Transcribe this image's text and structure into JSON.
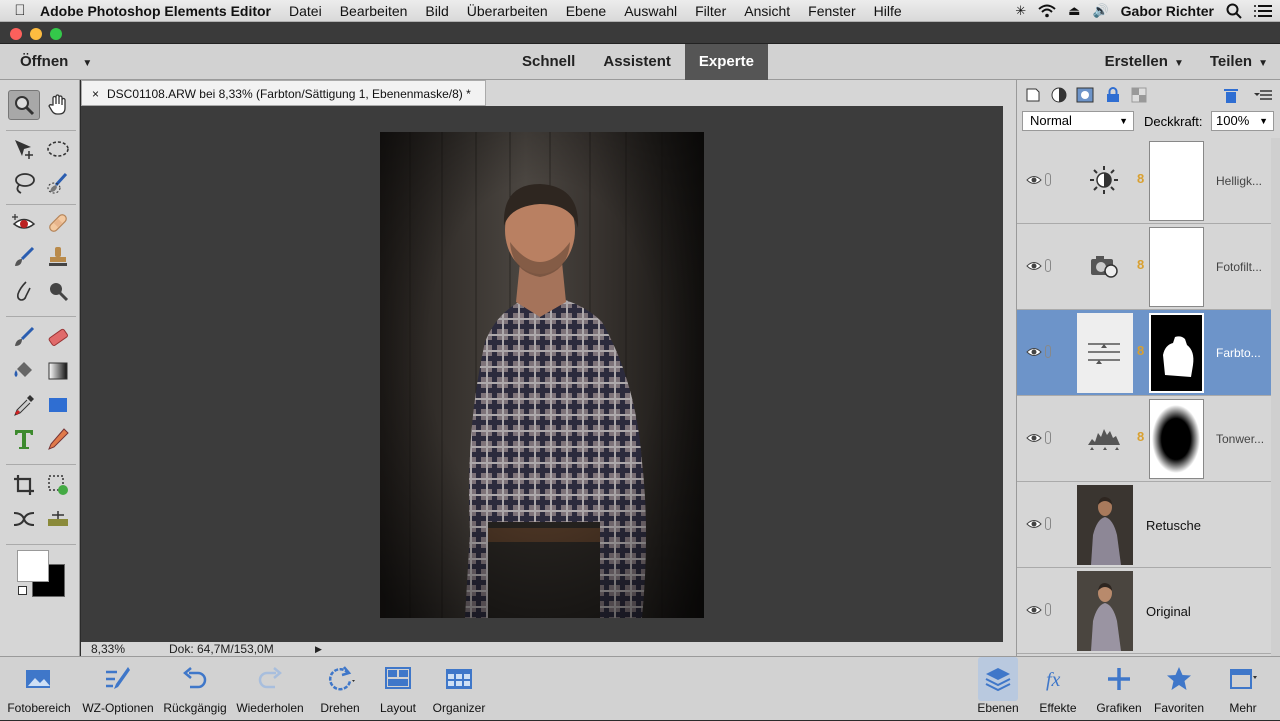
{
  "menubar": {
    "app_name": "Adobe Photoshop Elements Editor",
    "items": [
      "Datei",
      "Bearbeiten",
      "Bild",
      "Überarbeiten",
      "Ebene",
      "Auswahl",
      "Filter",
      "Ansicht",
      "Fenster",
      "Hilfe"
    ],
    "user": "Gabor Richter"
  },
  "topbar": {
    "open_label": "Öffnen",
    "modes": [
      "Schnell",
      "Assistent",
      "Experte"
    ],
    "active_mode": "Experte",
    "create_label": "Erstellen",
    "share_label": "Teilen"
  },
  "document": {
    "tab_close": "×",
    "tab_title": "DSC01108.ARW bei 8,33% (Farbton/Sättigung 1, Ebenenmaske/8) *"
  },
  "status": {
    "zoom": "8,33%",
    "doc_size": "Dok: 64,7M/153,0M"
  },
  "layers_panel": {
    "blend_mode": "Normal",
    "opacity_label": "Deckkraft:",
    "opacity_value": "100%",
    "layers": [
      {
        "name": "Helligk...",
        "type": "brightness-adjustment",
        "selected": false
      },
      {
        "name": "Fotofilt...",
        "type": "photo-filter-adjustment",
        "selected": false
      },
      {
        "name": "Farbto...",
        "type": "hue-saturation-adjustment",
        "selected": true
      },
      {
        "name": "Tonwer...",
        "type": "levels-adjustment",
        "selected": false
      },
      {
        "name": "Retusche",
        "type": "image",
        "selected": false
      },
      {
        "name": "Original",
        "type": "image",
        "selected": false
      }
    ]
  },
  "bottom_bar": {
    "left": [
      "Fotobereich",
      "WZ-Optionen",
      "Rückgängig",
      "Wiederholen",
      "Drehen",
      "Layout",
      "Organizer"
    ],
    "right": [
      "Ebenen",
      "Effekte",
      "Grafiken",
      "Favoriten",
      "Mehr"
    ]
  },
  "colors": {
    "accent": "#6d94c9",
    "active_mode_bg": "#555555",
    "chain_link": "#d9a030"
  }
}
